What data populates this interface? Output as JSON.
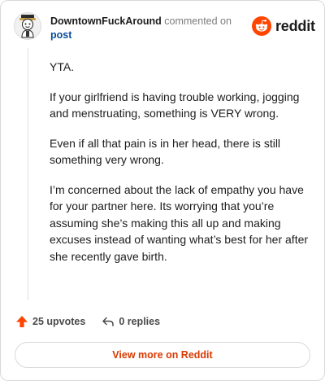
{
  "header": {
    "author": "DowntownFuckAround",
    "action": "commented on",
    "target": "post"
  },
  "brand": {
    "icon": "reddit-alien-icon",
    "wordmark": "reddit",
    "color": "#ff4500"
  },
  "comment": {
    "paragraphs": [
      "YTA.",
      "If your girlfriend is having trouble working, jogging and menstruating, something is VERY wrong.",
      "Even if all that pain is in her head, there is still something very wrong.",
      "I’m concerned about the lack of empathy you have for your partner here. Its worrying that you’re assuming she’s making this all up and making excuses instead of wanting what’s best for her after she recently gave birth."
    ]
  },
  "footer": {
    "upvotes_label": "25 upvotes",
    "replies_label": "0 replies",
    "view_more_label": "View more on Reddit"
  },
  "colors": {
    "accent": "#d93900",
    "link": "#0a4c99",
    "upvote": "#ff4500"
  }
}
